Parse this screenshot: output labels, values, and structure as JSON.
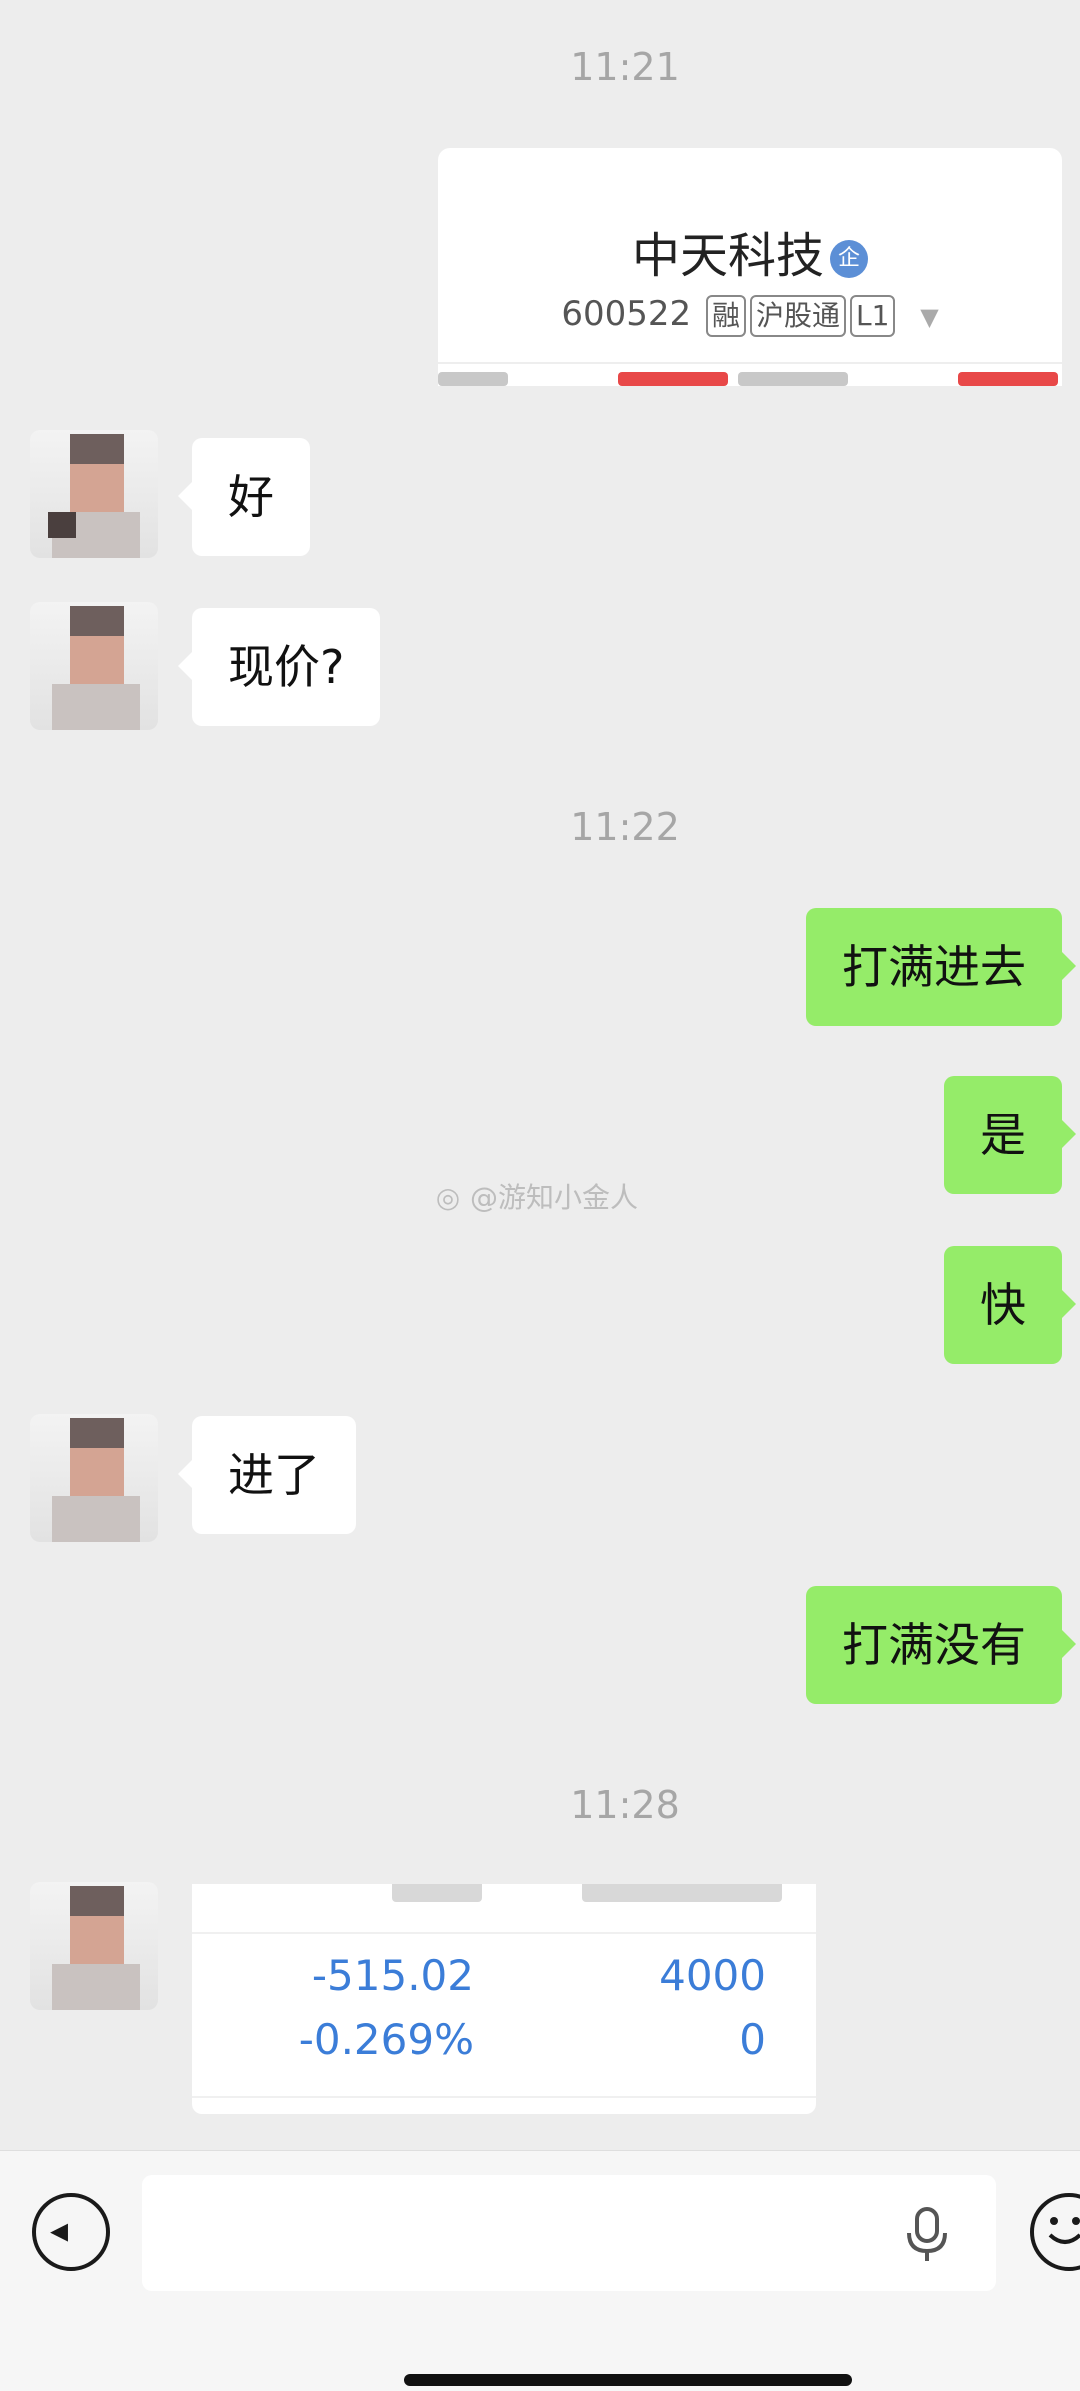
{
  "timestamps": [
    "11:21",
    "11:22",
    "11:28"
  ],
  "stock_card": {
    "name": "中天科技",
    "verified_badge": "企",
    "code": "600522",
    "tags": [
      "融",
      "沪股通",
      "L1"
    ]
  },
  "messages": {
    "m1": "好",
    "m2": "现价?",
    "m3": "打满进去",
    "m4": "是",
    "m5": "快",
    "m6": "进了",
    "m7": "打满没有"
  },
  "position_card": {
    "profit": "-515.02",
    "profit_pct": "-0.269%",
    "holding": "4000",
    "available": "0"
  },
  "watermark": "@游知小金人",
  "input": {
    "placeholder": ""
  },
  "icons": {
    "voice": "voice-toggle-icon",
    "mic": "microphone-icon",
    "emoji": "emoji-icon",
    "weibo": "weibo-icon"
  },
  "colors": {
    "background": "#ededed",
    "bubble_sent": "#95ec69",
    "bubble_received": "#ffffff",
    "loss_blue": "#3b7dd8"
  }
}
